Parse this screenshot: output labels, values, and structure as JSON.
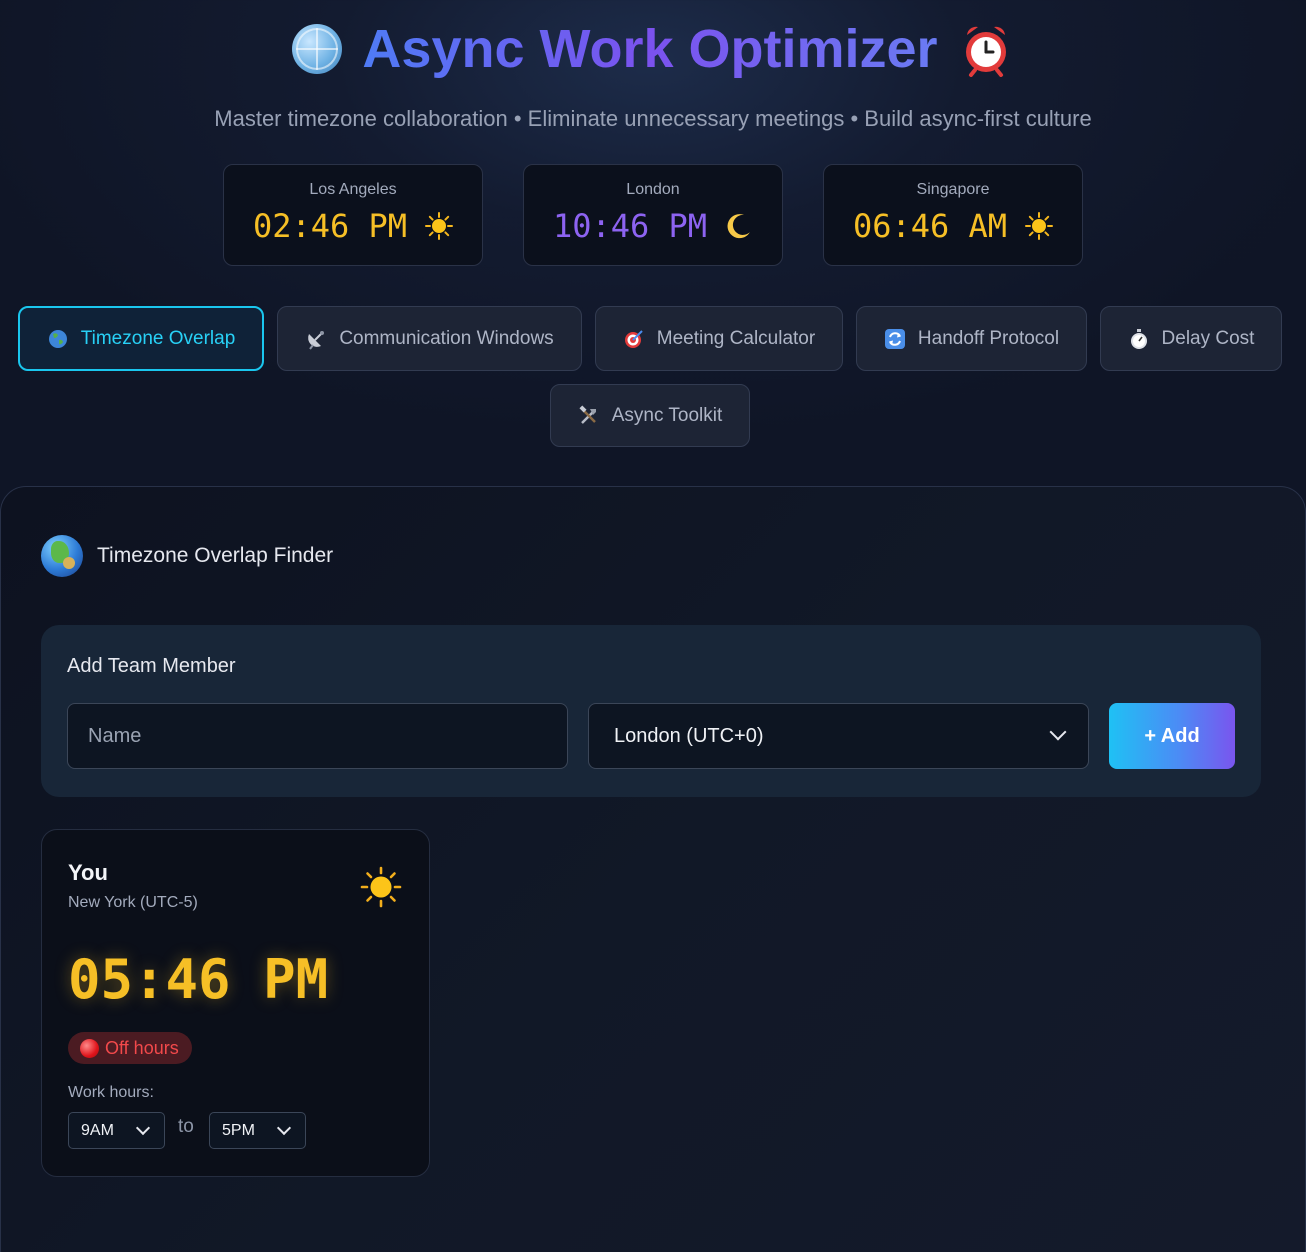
{
  "header": {
    "title": "Async Work Optimizer",
    "subtitle": "Master timezone collaboration • Eliminate unnecessary meetings • Build async-first culture"
  },
  "clocks": [
    {
      "city": "Los Angeles",
      "time": "02:46 PM",
      "period": "day"
    },
    {
      "city": "London",
      "time": "10:46 PM",
      "period": "night"
    },
    {
      "city": "Singapore",
      "time": "06:46 AM",
      "period": "day"
    }
  ],
  "tabs": [
    {
      "label": "Timezone Overlap",
      "icon": "globe-icon",
      "active": true
    },
    {
      "label": "Communication Windows",
      "icon": "satellite-dish-icon",
      "active": false
    },
    {
      "label": "Meeting Calculator",
      "icon": "target-icon",
      "active": false
    },
    {
      "label": "Handoff Protocol",
      "icon": "refresh-icon",
      "active": false
    },
    {
      "label": "Delay Cost",
      "icon": "stopwatch-icon",
      "active": false
    },
    {
      "label": "Async Toolkit",
      "icon": "tools-icon",
      "active": false
    }
  ],
  "panel": {
    "title": "Timezone Overlap Finder",
    "add_member": {
      "label": "Add Team Member",
      "name_placeholder": "Name",
      "timezone_selected": "London (UTC+0)",
      "add_button": "+ Add"
    },
    "member": {
      "name": "You",
      "timezone": "New York (UTC-5)",
      "time": "05:46 PM",
      "status": "Off hours",
      "work_hours_label": "Work hours:",
      "start": "9AM",
      "to_label": "to",
      "end": "5PM"
    }
  },
  "colors": {
    "accent_cyan": "#1ac6ee",
    "day_time": "#f6bf26",
    "night_time": "#8d63f1",
    "status_off": "#f2494b"
  }
}
